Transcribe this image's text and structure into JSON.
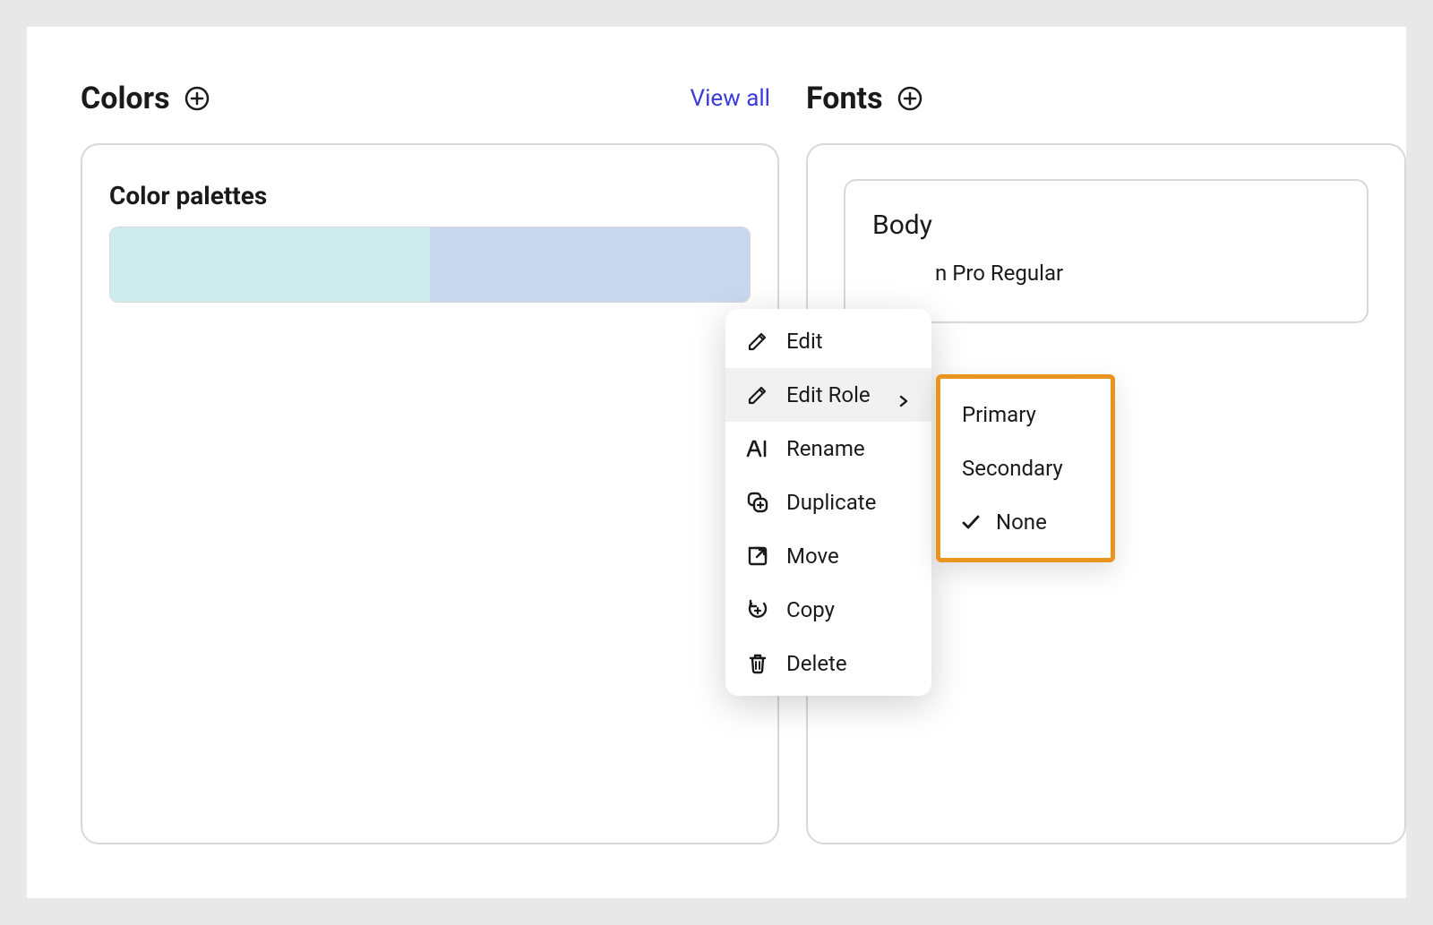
{
  "sections": {
    "colors": {
      "title": "Colors",
      "view_all": "View all",
      "palette_title": "Color palettes",
      "swatches": [
        "#cdeceb",
        "#c9d7ef"
      ]
    },
    "fonts": {
      "title": "Fonts",
      "body_label": "Body",
      "font_name_fragment": "n Pro Regular"
    }
  },
  "context_menu": {
    "items": [
      {
        "icon": "pencil",
        "label": "Edit"
      },
      {
        "icon": "pencil",
        "label": "Edit Role",
        "submenu": true,
        "highlight": true
      },
      {
        "icon": "ai",
        "label": "Rename"
      },
      {
        "icon": "duplicate",
        "label": "Duplicate"
      },
      {
        "icon": "move",
        "label": "Move"
      },
      {
        "icon": "copy",
        "label": "Copy"
      },
      {
        "icon": "delete",
        "label": "Delete"
      }
    ]
  },
  "submenu": {
    "items": [
      {
        "label": "Primary",
        "checked": false
      },
      {
        "label": "Secondary",
        "checked": false
      },
      {
        "label": "None",
        "checked": true
      }
    ]
  }
}
